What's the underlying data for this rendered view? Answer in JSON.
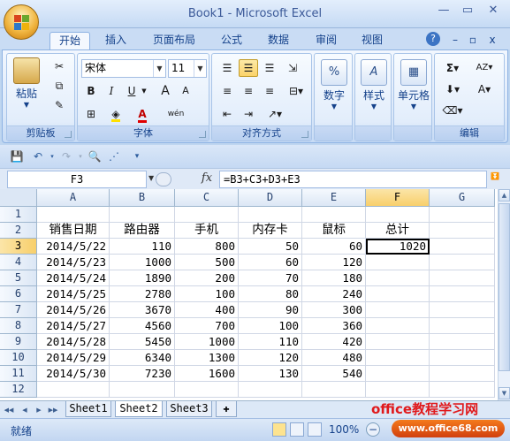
{
  "window": {
    "title": "Book1 - Microsoft Excel",
    "minimize": "—",
    "restore": "▭",
    "close": "✕"
  },
  "tabs": [
    "开始",
    "插入",
    "页面布局",
    "公式",
    "数据",
    "审阅",
    "视图"
  ],
  "tab_right_icons": {
    "help": "?",
    "min": "–",
    "restore": "▫",
    "close": "x"
  },
  "ribbon": {
    "clipboard": {
      "label": "剪贴板",
      "paste": "粘贴"
    },
    "font": {
      "label": "字体",
      "name": "宋体",
      "size": "11",
      "bold": "B",
      "italic": "I",
      "underline": "U",
      "grow": "A",
      "shrink": "A",
      "color_letter": "A",
      "phonetic": "wén"
    },
    "alignment": {
      "label": "对齐方式"
    },
    "number": {
      "label": "",
      "button": "数字",
      "icon_text": "%"
    },
    "styles": {
      "button": "样式",
      "icon_text": "A"
    },
    "cells": {
      "button": "单元格"
    },
    "editing": {
      "label": "编辑",
      "sum": "Σ",
      "sort": "AZ",
      "find": "A"
    }
  },
  "formula_bar": {
    "name_box": "F3",
    "fx": "fx",
    "formula": "=B3+C3+D3+E3"
  },
  "columns": [
    "A",
    "B",
    "C",
    "D",
    "E",
    "F",
    "G"
  ],
  "rows": [
    "1",
    "2",
    "3",
    "4",
    "5",
    "6",
    "7",
    "8",
    "9",
    "10",
    "11",
    "12"
  ],
  "headers": [
    "销售日期",
    "路由器",
    "手机",
    "内存卡",
    "鼠标",
    "总计"
  ],
  "data": [
    [
      "2014/5/22",
      "110",
      "800",
      "50",
      "60",
      "1020"
    ],
    [
      "2014/5/23",
      "1000",
      "500",
      "60",
      "120",
      ""
    ],
    [
      "2014/5/24",
      "1890",
      "200",
      "70",
      "180",
      ""
    ],
    [
      "2014/5/25",
      "2780",
      "100",
      "80",
      "240",
      ""
    ],
    [
      "2014/5/26",
      "3670",
      "400",
      "90",
      "300",
      ""
    ],
    [
      "2014/5/27",
      "4560",
      "700",
      "100",
      "360",
      ""
    ],
    [
      "2014/5/28",
      "5450",
      "1000",
      "110",
      "420",
      ""
    ],
    [
      "2014/5/29",
      "6340",
      "1300",
      "120",
      "480",
      ""
    ],
    [
      "2014/5/30",
      "7230",
      "1600",
      "130",
      "540",
      ""
    ]
  ],
  "active_cell": "F3",
  "sheets": [
    "Sheet1",
    "Sheet2",
    "Sheet3"
  ],
  "active_sheet": "Sheet2",
  "status": {
    "ready": "就绪",
    "zoom": "100%"
  },
  "watermark": {
    "line1": "office教程学习网",
    "line2": "www.office68.com"
  },
  "colors": {
    "accent": "#15428b",
    "active_tab_bg": "#f4f8fe",
    "selected_header": "#f8cf6b"
  }
}
